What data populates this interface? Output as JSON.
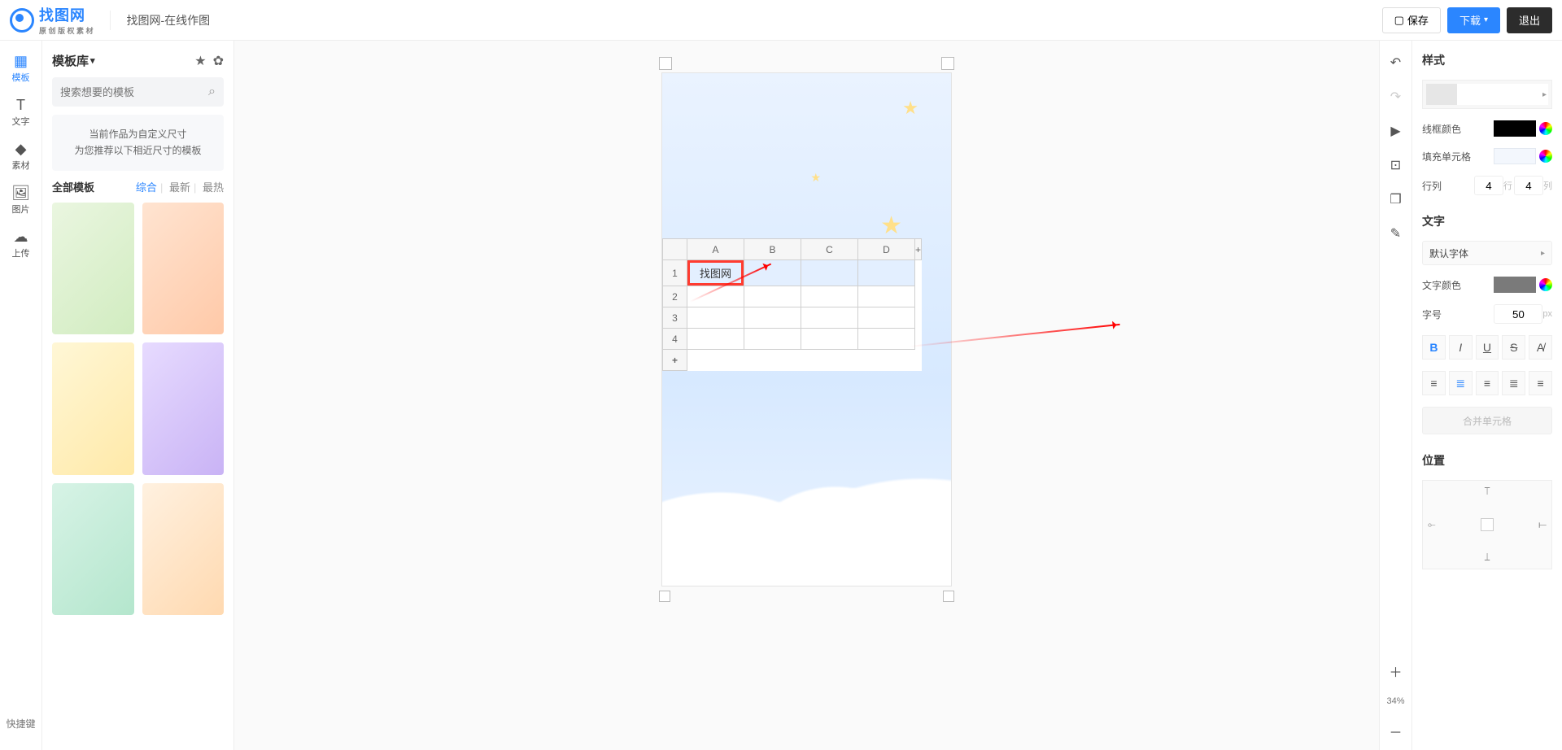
{
  "header": {
    "logo_text": "找图网",
    "logo_sub": "原 创 版 权 素 材",
    "page_title": "找图网-在线作图",
    "save": "保存",
    "download": "下载",
    "exit": "退出"
  },
  "rail": {
    "items": [
      {
        "label": "模板",
        "icon": "▦"
      },
      {
        "label": "文字",
        "icon": "T"
      },
      {
        "label": "素材",
        "icon": "◆"
      },
      {
        "label": "图片",
        "icon": "🖼"
      },
      {
        "label": "上传",
        "icon": "☁"
      }
    ],
    "foot": "快捷键"
  },
  "side": {
    "title": "模板库",
    "search_placeholder": "搜索想要的模板",
    "note_l1": "当前作品为自定义尺寸",
    "note_l2": "为您推荐以下相近尺寸的模板",
    "tabs": {
      "all": "全部模板",
      "items": [
        "综合",
        "最新",
        "最热"
      ],
      "active": 0
    },
    "templates": [
      {
        "c1": "#eaf6e0",
        "c2": "#d1ecc0"
      },
      {
        "c1": "#ffe4d1",
        "c2": "#ffc9a8"
      },
      {
        "c1": "#fff7d6",
        "c2": "#ffe9a8"
      },
      {
        "c1": "#e7dbff",
        "c2": "#c9b3f5"
      },
      {
        "c1": "#d7f3e6",
        "c2": "#b4e6cd"
      },
      {
        "c1": "#fff1e0",
        "c2": "#ffd9b0"
      }
    ]
  },
  "canvas": {
    "sheet": {
      "cols": [
        "A",
        "B",
        "C",
        "D"
      ],
      "rows": [
        1,
        2,
        3,
        4
      ],
      "sel_value": "找图网"
    }
  },
  "rt": {
    "zoom": "34%"
  },
  "prop": {
    "style_title": "样式",
    "border_color": "线框颜色",
    "fill_cell": "填充单元格",
    "rowcol": "行列",
    "rows": "4",
    "row_u": "行",
    "cols": "4",
    "col_u": "列",
    "text_title": "文字",
    "font": "默认字体",
    "text_color": "文字颜色",
    "font_size_label": "字号",
    "font_size": "50",
    "font_size_unit": "px",
    "merge": "合并单元格",
    "pos_title": "位置"
  }
}
